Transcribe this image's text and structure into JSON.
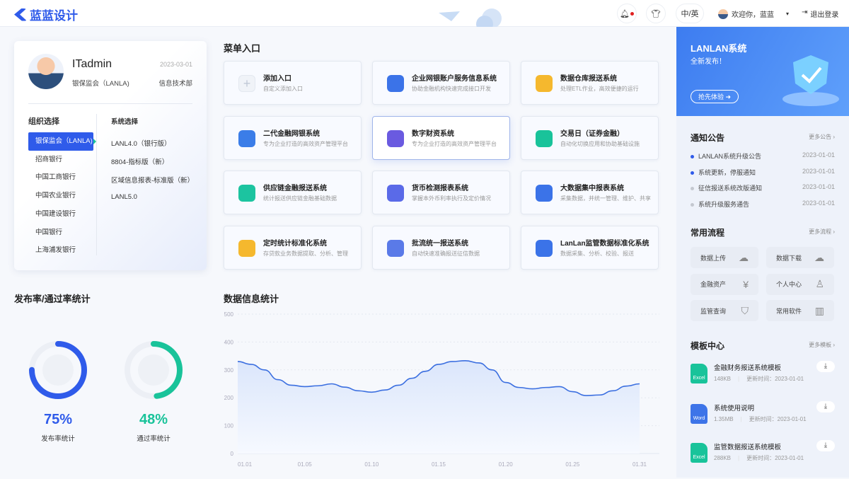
{
  "header": {
    "logo": "蓝蓝设计",
    "lang": "中/英",
    "welcome": "欢迎你，蓝蓝",
    "logout": "退出登录"
  },
  "profile": {
    "name": "ITadmin",
    "date": "2023-03-01",
    "org": "银保监会（LANLA)",
    "dept": "信息技术部"
  },
  "org_select": {
    "title": "组织选择",
    "items": [
      "银保监会（LANLA)",
      "招商银行",
      "中国工商银行",
      "中国农业银行",
      "中国建设银行",
      "中国银行",
      "上海浦发银行"
    ],
    "active": 0
  },
  "sys_select": {
    "title": "系统选择",
    "items": [
      "LANL4.0（银行版）",
      "8804-指标版（新）",
      "区域信息报表-标准版（新）",
      "LANL5.0"
    ]
  },
  "menu": {
    "title": "菜单入口",
    "items": [
      {
        "title": "添加入口",
        "sub": "自定义添加入口",
        "color": "#eef1f6"
      },
      {
        "title": "企业网银账户服务信息系统",
        "sub": "协助金融机构快速完成接口开发",
        "color": "#3b73e8"
      },
      {
        "title": "数据仓库报送系统",
        "sub": "处理ETL作业，高效便捷的运行",
        "color": "#f5b82e"
      },
      {
        "title": "二代金融网银系统",
        "sub": "专为企业打造的高效资产管理平台",
        "color": "#3b7de8"
      },
      {
        "title": "数字财资系统",
        "sub": "专为企业打造的高效资产管理平台",
        "color": "#6a5ae0"
      },
      {
        "title": "交易日（证券金融）",
        "sub": "自动化切换应用和协助基础设施",
        "color": "#19c39a"
      },
      {
        "title": "供应链金融报送系统",
        "sub": "统计报送供应链金融基础数据",
        "color": "#1cc4a0"
      },
      {
        "title": "货币检测报表系统",
        "sub": "掌握本外币利率执行及定价情况",
        "color": "#5a6ae8"
      },
      {
        "title": "大数据集中报表系统",
        "sub": "采集数据，并统一管理、维护、共享",
        "color": "#3b73e8"
      },
      {
        "title": "定时统计标准化系统",
        "sub": "存贷款业务数据提取、分析、管理",
        "color": "#f5b82e"
      },
      {
        "title": "批流统一报送系统",
        "sub": "自动快速准确报送征信数据",
        "color": "#5a7ae8"
      },
      {
        "title": "LanLan监管数据标准化系统",
        "sub": "数据采集、分析、校验、报送",
        "color": "#3b73e8"
      }
    ],
    "selected": 4
  },
  "rates": {
    "title": "发布率/通过率统计",
    "items": [
      {
        "value": "75%",
        "pct": 75,
        "label": "发布率统计",
        "color": "#2f5bea"
      },
      {
        "value": "48%",
        "pct": 48,
        "label": "通过率统计",
        "color": "#19c39a"
      }
    ]
  },
  "chart_data": {
    "type": "area",
    "title": "数据信息统计",
    "ylim": [
      0,
      500
    ],
    "yticks": [
      0,
      100,
      200,
      300,
      400,
      500
    ],
    "xticks": [
      "01.01",
      "01.05",
      "01.10",
      "01.15",
      "01.20",
      "01.25",
      "01.31"
    ],
    "values": [
      330,
      320,
      300,
      265,
      245,
      240,
      243,
      250,
      238,
      225,
      220,
      228,
      245,
      270,
      295,
      320,
      330,
      333,
      325,
      300,
      255,
      237,
      232,
      237,
      240,
      222,
      208,
      210,
      225,
      242,
      250
    ],
    "color": "#3b6fe0",
    "grid": true
  },
  "banner": {
    "title": "LANLAN系统",
    "sub": "全新发布！",
    "button": "抢先体验"
  },
  "notices": {
    "title": "通知公告",
    "more": "更多公告",
    "items": [
      {
        "text": "LANLAN系统升级公告",
        "date": "2023-01-01",
        "unread": true
      },
      {
        "text": "系统更新，停服通知",
        "date": "2023-01-01",
        "unread": true
      },
      {
        "text": "征信报送系统改版通知",
        "date": "2023-01-01",
        "unread": false
      },
      {
        "text": "系统升级服务通告",
        "date": "2023-01-01",
        "unread": false
      }
    ]
  },
  "flows": {
    "title": "常用流程",
    "more": "更多流程",
    "items": [
      {
        "label": "数据上传",
        "icon": "cloud-upload"
      },
      {
        "label": "数据下载",
        "icon": "cloud-download"
      },
      {
        "label": "金融资产",
        "icon": "yen-ticket"
      },
      {
        "label": "个人中心",
        "icon": "user"
      },
      {
        "label": "监管查询",
        "icon": "shield-search"
      },
      {
        "label": "常用软件",
        "icon": "building"
      }
    ]
  },
  "templates": {
    "title": "模板中心",
    "more": "更多模板",
    "items": [
      {
        "name": "金融财务报送系统模板",
        "type": "Excel",
        "size": "148KB",
        "updated": "更新时间：2023-01-01"
      },
      {
        "name": "系统使用说明",
        "type": "Word",
        "size": "1.35MB",
        "updated": "更新时间：2023-01-01"
      },
      {
        "name": "监管数据报送系统模板",
        "type": "Excel",
        "size": "288KB",
        "updated": "更新时间：2023-01-01"
      }
    ]
  }
}
